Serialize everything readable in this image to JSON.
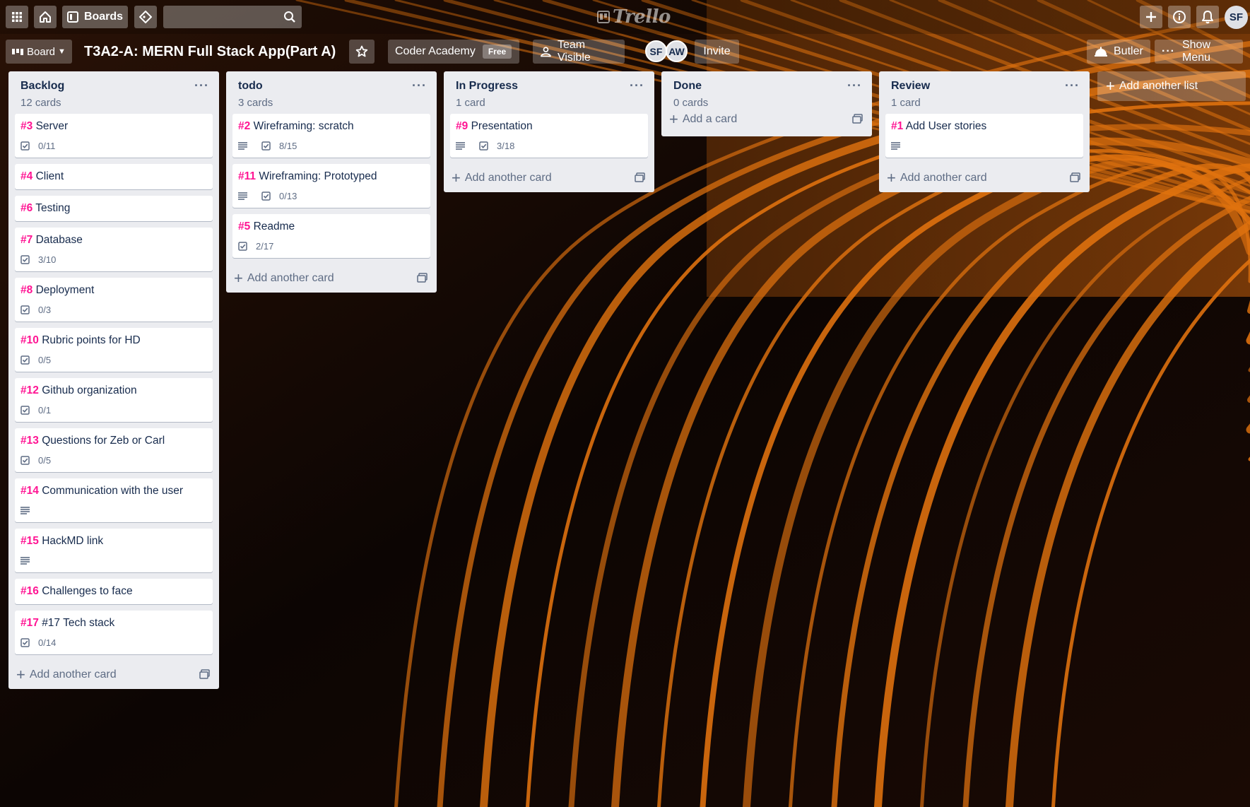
{
  "topbar": {
    "boards_label": "Boards",
    "search_value": "",
    "logo_text": "Trello",
    "user_initials": "SF"
  },
  "board_header": {
    "board_menu_label": "Board",
    "title": "T3A2-A: MERN Full Stack App(Part A)",
    "team_name": "Coder Academy",
    "team_plan": "Free",
    "visibility_label": "Team Visible",
    "members": [
      "SF",
      "AW"
    ],
    "invite_label": "Invite",
    "butler_label": "Butler",
    "show_menu_label": "Show Menu"
  },
  "lists": [
    {
      "name": "Backlog",
      "count": "12 cards",
      "cards": [
        {
          "num": "#3",
          "title": "Server",
          "description": false,
          "checklist": "0/11"
        },
        {
          "num": "#4",
          "title": "Client",
          "description": false,
          "checklist": ""
        },
        {
          "num": "#6",
          "title": "Testing",
          "description": false,
          "checklist": ""
        },
        {
          "num": "#7",
          "title": "Database",
          "description": false,
          "checklist": "3/10"
        },
        {
          "num": "#8",
          "title": "Deployment",
          "description": false,
          "checklist": "0/3"
        },
        {
          "num": "#10",
          "title": "Rubric points for HD",
          "description": false,
          "checklist": "0/5"
        },
        {
          "num": "#12",
          "title": "Github organization",
          "description": false,
          "checklist": "0/1"
        },
        {
          "num": "#13",
          "title": "Questions for Zeb or Carl",
          "description": false,
          "checklist": "0/5"
        },
        {
          "num": "#14",
          "title": "Communication with the user",
          "description": true,
          "checklist": ""
        },
        {
          "num": "#15",
          "title": "HackMD link",
          "description": true,
          "checklist": ""
        },
        {
          "num": "#16",
          "title": "Challenges to face",
          "description": false,
          "checklist": ""
        },
        {
          "num": "#17",
          "title": "#17 Tech stack",
          "description": false,
          "checklist": "0/14"
        }
      ],
      "add_label": "Add another card"
    },
    {
      "name": "todo",
      "count": "3 cards",
      "cards": [
        {
          "num": "#2",
          "title": "Wireframing: scratch",
          "description": true,
          "checklist": "8/15"
        },
        {
          "num": "#11",
          "title": "Wireframing: Prototyped",
          "description": true,
          "checklist": "0/13"
        },
        {
          "num": "#5",
          "title": "Readme",
          "description": false,
          "checklist": "2/17"
        }
      ],
      "add_label": "Add another card"
    },
    {
      "name": "In Progress",
      "count": "1 card",
      "cards": [
        {
          "num": "#9",
          "title": "Presentation",
          "description": true,
          "checklist": "3/18"
        }
      ],
      "add_label": "Add another card"
    },
    {
      "name": "Done",
      "count": "0 cards",
      "cards": [],
      "add_label": "Add a card"
    },
    {
      "name": "Review",
      "count": "1 card",
      "cards": [
        {
          "num": "#1",
          "title": "Add User stories",
          "description": true,
          "checklist": ""
        }
      ],
      "add_label": "Add another card"
    }
  ],
  "add_list_label": "Add another list",
  "colors": {
    "card_number": "#ff1493",
    "list_bg": "#ebecf0",
    "stripe": "#e0720f"
  }
}
